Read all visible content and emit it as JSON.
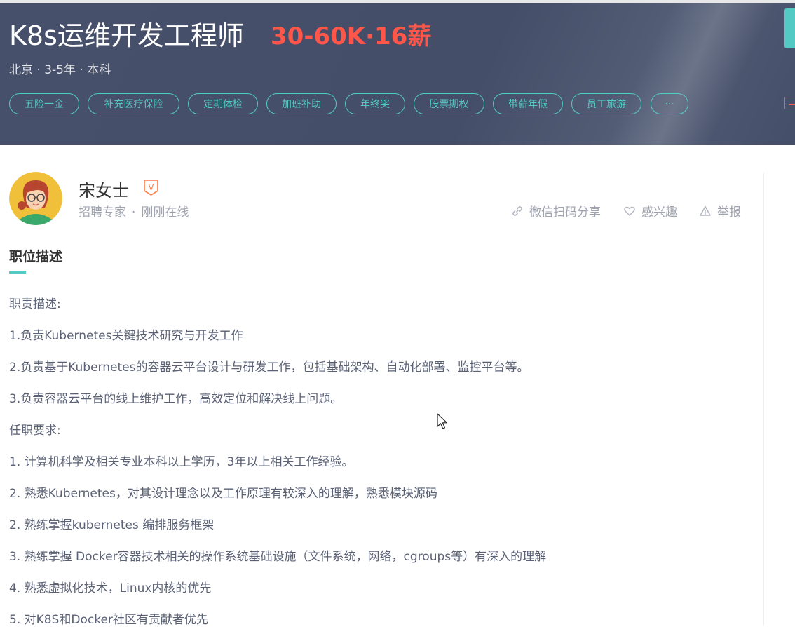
{
  "job": {
    "title": "K8s运维开发工程师",
    "salary": "30-60K·16薪",
    "meta": "北京 · 3-5年 · 本科",
    "tags": [
      "五险一金",
      "补充医疗保险",
      "定期体检",
      "加班补助",
      "年终奖",
      "股票期权",
      "带薪年假",
      "员工旅游",
      "···"
    ]
  },
  "recruiter": {
    "name": "宋女士",
    "role": "招聘专家",
    "dot": "·",
    "status": "刚刚在线",
    "verify_badge": "V"
  },
  "actions": {
    "share": "微信扫码分享",
    "interest": "感兴趣",
    "report": "举报"
  },
  "description": {
    "title": "职位描述",
    "lines": [
      "职责描述:",
      "1.负责Kubernetes关键技术研究与开发工作",
      "2.负责基于Kubernetes的容器云平台设计与研发工作，包括基础架构、自动化部署、监控平台等。",
      "3.负责容器云平台的线上维护工作，高效定位和解决线上问题。",
      "任职要求:",
      "1. 计算机科学及相关专业本科以上学历，3年以上相关工作经验。",
      "2. 熟悉Kubernetes，对其设计理念以及工作原理有较深入的理解，熟悉模块源码",
      "2. 熟练掌握kubernetes 编排服务框架",
      "3. 熟练掌握 Docker容器技术相关的操作系统基础设施（文件系统，网络，cgroups等）有深入的理解",
      "4. 熟悉虚拟化技术，Linux内核的优先",
      "5. 对K8S和Docker社区有贡献者优先"
    ]
  },
  "colors": {
    "banner": "#454e68",
    "accent": "#53cac3",
    "salary": "#fe574a"
  },
  "icons": [
    "link-icon",
    "heart-icon",
    "warning-icon",
    "verified-badge-icon",
    "cursor-icon"
  ]
}
